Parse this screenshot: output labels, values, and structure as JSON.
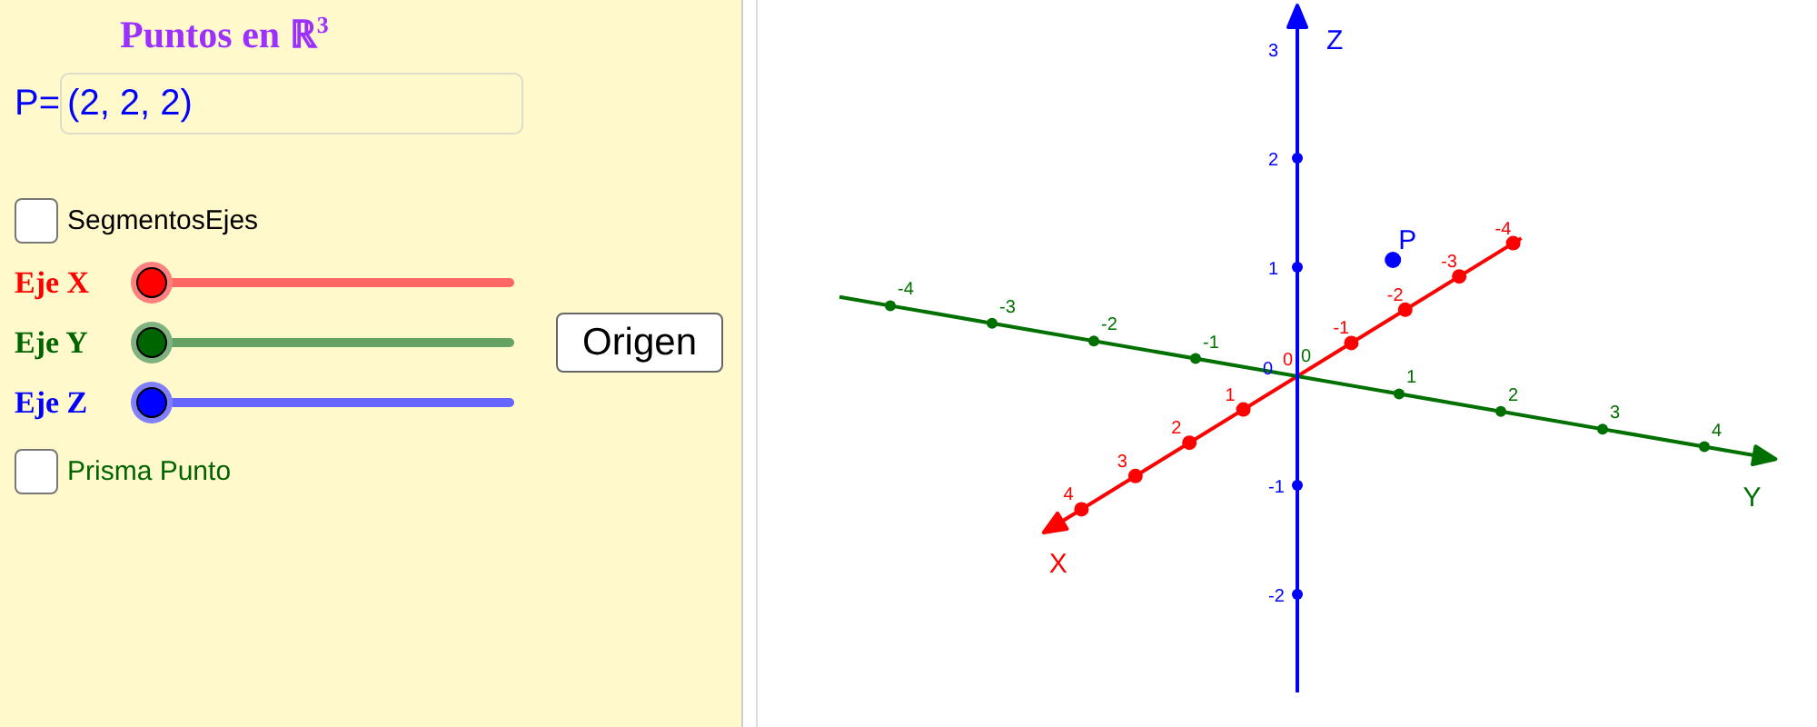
{
  "title": "Puntos en ℝ$^{3}$",
  "point_input": {
    "label": "P=",
    "value": "(2, 2, 2)"
  },
  "checkboxes": [
    {
      "label": "SegmentosEjes",
      "checked": false,
      "color": "#000000"
    }
  ],
  "sliders": [
    {
      "label": "Eje X",
      "level": 0,
      "color": "#ff0000"
    },
    {
      "label": "Eje Y",
      "level": 0,
      "color": "#006400"
    },
    {
      "label": "Eje Z",
      "level": 0,
      "color": "#0000ff"
    }
  ],
  "button": "Origen",
  "checkboxes_2": [
    {
      "label": "Prisma Punto",
      "checked": false,
      "color": "#006400"
    }
  ],
  "view3d": {
    "axes": [
      {
        "name": "X",
        "color": "#ff0000",
        "ticks": [
          "-4",
          "-3",
          "-2",
          "-1",
          "0",
          "1",
          "2",
          "3",
          "4"
        ]
      },
      {
        "name": "Y",
        "color": "#007000",
        "ticks": [
          "-4",
          "-3",
          "-2",
          "-1",
          "0",
          "1",
          "2",
          "3",
          "4"
        ]
      },
      {
        "name": "Z",
        "color": "#0000ff",
        "ticks": [
          "3",
          "2",
          "1",
          "0",
          "-1",
          "-2"
        ]
      }
    ],
    "point": {
      "label": "P",
      "color": "#0000ff"
    }
  }
}
